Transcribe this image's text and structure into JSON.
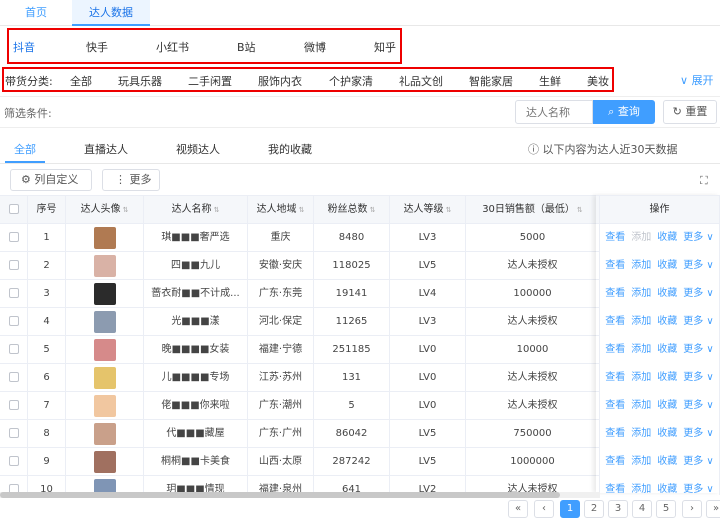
{
  "topnav": {
    "home": "首页",
    "talent": "达人数据"
  },
  "platforms": [
    "抖音",
    "快手",
    "小红书",
    "B站",
    "微博",
    "知乎"
  ],
  "categories": {
    "label": "带货分类:",
    "items": [
      "全部",
      "玩具乐器",
      "二手闲置",
      "服饰内衣",
      "个护家清",
      "礼品文创",
      "智能家居",
      "生鲜",
      "美妆"
    ],
    "expand": "展开"
  },
  "filter": {
    "label": "筛选条件:",
    "search_placeholder": "达人名称",
    "search_btn": "查询",
    "reset_btn": "重置"
  },
  "subtabs": [
    "全部",
    "直播达人",
    "视频达人",
    "我的收藏"
  ],
  "notice": "以下内容为达人近30天数据",
  "toolbar": {
    "custom_columns": "列自定义",
    "more": "更多"
  },
  "table": {
    "headers": [
      "序号",
      "达人头像",
      "达人名称",
      "达人地域",
      "粉丝总数",
      "达人等级",
      "30日销售额（最低）",
      "操作"
    ],
    "rows": [
      {
        "idx": "1",
        "name": "琪■■■奢严选",
        "region": "重庆",
        "fans": "8480",
        "level": "LV3",
        "sales": "5000"
      },
      {
        "idx": "2",
        "name": "四■■九儿",
        "region": "安徽·安庆",
        "fans": "118025",
        "level": "LV5",
        "sales": "达人未授权"
      },
      {
        "idx": "3",
        "name": "蔷衣耐■■不计成...",
        "region": "广东·东莞",
        "fans": "19141",
        "level": "LV4",
        "sales": "100000"
      },
      {
        "idx": "4",
        "name": "光■■■漾",
        "region": "河北·保定",
        "fans": "11265",
        "level": "LV3",
        "sales": "达人未授权"
      },
      {
        "idx": "5",
        "name": "晚■■■■女装",
        "region": "福建·宁德",
        "fans": "251185",
        "level": "LV0",
        "sales": "10000"
      },
      {
        "idx": "6",
        "name": "儿■■■■专场",
        "region": "江苏·苏州",
        "fans": "131",
        "level": "LV0",
        "sales": "达人未授权"
      },
      {
        "idx": "7",
        "name": "佬■■■你来啦",
        "region": "广东·潮州",
        "fans": "5",
        "level": "LV0",
        "sales": "达人未授权"
      },
      {
        "idx": "8",
        "name": "代■■■藏屋",
        "region": "广东·广州",
        "fans": "86042",
        "level": "LV5",
        "sales": "750000"
      },
      {
        "idx": "9",
        "name": "桐桐■■卡美食",
        "region": "山西·太原",
        "fans": "287242",
        "level": "LV5",
        "sales": "1000000"
      },
      {
        "idx": "10",
        "name": "玥■■■情现",
        "region": "福建·泉州",
        "fans": "641",
        "level": "LV2",
        "sales": "达人未授权"
      }
    ],
    "ops": {
      "view": "查看",
      "add": "添加",
      "fav": "收藏",
      "more": "更多"
    }
  },
  "pagination": {
    "pages": [
      "1",
      "2",
      "3",
      "4",
      "5"
    ],
    "current": "1"
  }
}
